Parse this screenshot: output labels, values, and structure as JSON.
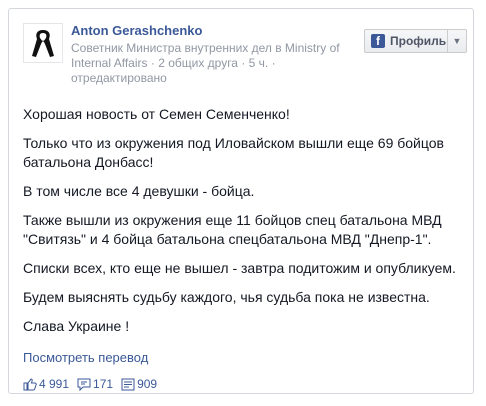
{
  "post": {
    "author": "Anton Gerashchenko",
    "meta": {
      "title": "Советник Министра внутренних дел в Ministry of Internal Affairs",
      "friends": "2 общих друга",
      "time": "5 ч.",
      "edited": "отредактировано",
      "separator": "·"
    },
    "profile_button": {
      "label": "Профиль",
      "icon": "facebook-f-icon"
    },
    "paragraphs": [
      "Хорошая новость от Семен Семенченко!",
      "Только что из окружения под Иловайском вышли еще 69 бойцов батальона Донбасс!",
      "В том числе все 4 девушки - бойца.",
      "Также вышли из окружения еще 11 бойцов спец батальона МВД \"Свитязь\" и 4 бойца батальона спецбатальона МВД \"Днепр-1\".",
      "Списки всех, кто еще не вышел - завтра подитожим и опубликуем.",
      "Будем выяснять судьбу каждого, чья судьба пока не известна.",
      "Слава Украине !"
    ],
    "translate_link": "Посмотреть перевод",
    "stats": {
      "likes": "4 991",
      "comments": "171",
      "shares": "909"
    }
  },
  "colors": {
    "link": "#3b5998",
    "meta": "#9197a3",
    "text": "#141823"
  }
}
